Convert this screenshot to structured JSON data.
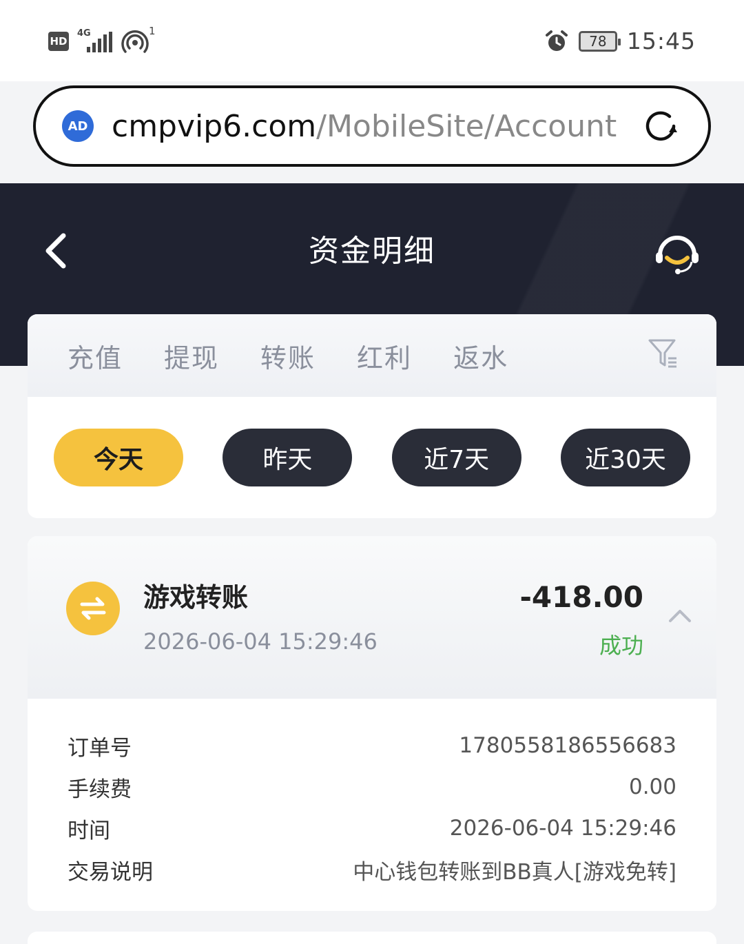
{
  "status_bar": {
    "hd": "HD",
    "network": "4G",
    "hotspot_count": "1",
    "battery": "78",
    "time": "15:45"
  },
  "browser": {
    "ad_badge": "AD",
    "url_domain": "cmpvip6.com",
    "url_path": "/MobileSite/Account"
  },
  "header": {
    "title": "资金明细"
  },
  "tabs": [
    "充值",
    "提现",
    "转账",
    "红利",
    "返水"
  ],
  "date_ranges": [
    "今天",
    "昨天",
    "近7天",
    "近30天"
  ],
  "active_range": "今天",
  "record": {
    "title": "游戏转账",
    "time": "2026-06-04 15:29:46",
    "amount": "-418.00",
    "status": "成功",
    "status_color": "#4caf50",
    "details": [
      {
        "label": "订单号",
        "value": "1780558186556683"
      },
      {
        "label": "手续费",
        "value": "0.00"
      },
      {
        "label": "时间",
        "value": "2026-06-04 15:29:46"
      },
      {
        "label": "交易说明",
        "value": "中心钱包转账到BB真人[游戏免转]"
      }
    ]
  },
  "colors": {
    "accent": "#f5c23e",
    "header_bg": "#1f2230",
    "dark_button": "#2a2d38"
  },
  "icons": {
    "back": "chevron-left-icon",
    "support": "headset-icon",
    "filter": "filter-icon",
    "record": "transfer-arrows-icon",
    "collapse": "chevron-up-icon",
    "reload": "reload-icon"
  }
}
